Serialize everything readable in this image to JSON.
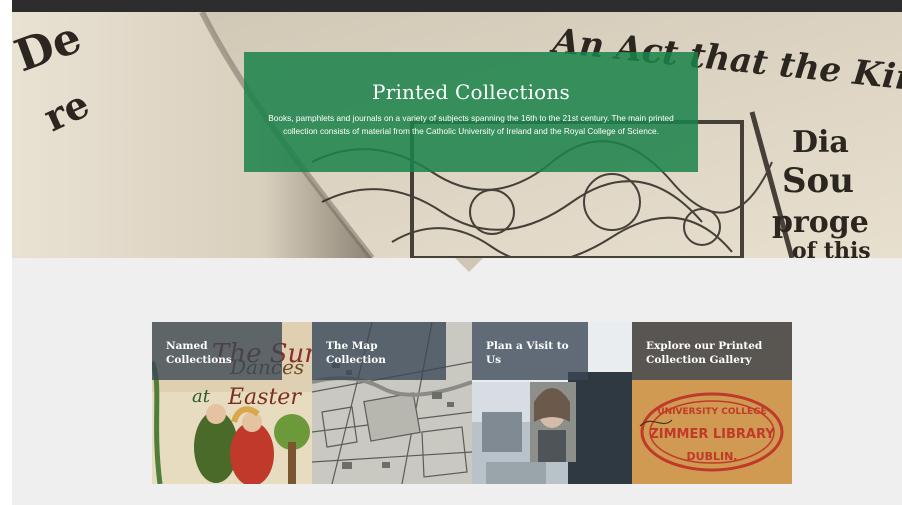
{
  "hero": {
    "title": "Printed Collections",
    "description": "Books, pamphlets and journals on a variety of subjects spanning the 16th to the 21st century. The main printed collection consists of material from the Catholic University of Ireland and the Royal College of Science.",
    "background_text": [
      "An Act that the Kin",
      "Dia",
      "Sou",
      "proge",
      "of this",
      "De",
      "re"
    ]
  },
  "tiles": [
    {
      "label": "Named Collections",
      "image_text": [
        "The Sun",
        "Dances",
        "at",
        "Easter"
      ]
    },
    {
      "label": "The Map Collection"
    },
    {
      "label": "Plan a Visit to Us"
    },
    {
      "label": "Explore our Printed Collection Gallery",
      "image_text": [
        "UNIVERSITY COLLEGE",
        "ZIMMER LIBRARY",
        "DUBLIN."
      ]
    }
  ],
  "colors": {
    "hero_box": "#1b824a",
    "tile_label_bg": "#3a4654",
    "page_bg": "#efefef",
    "stamp_red": "#c0392b"
  }
}
